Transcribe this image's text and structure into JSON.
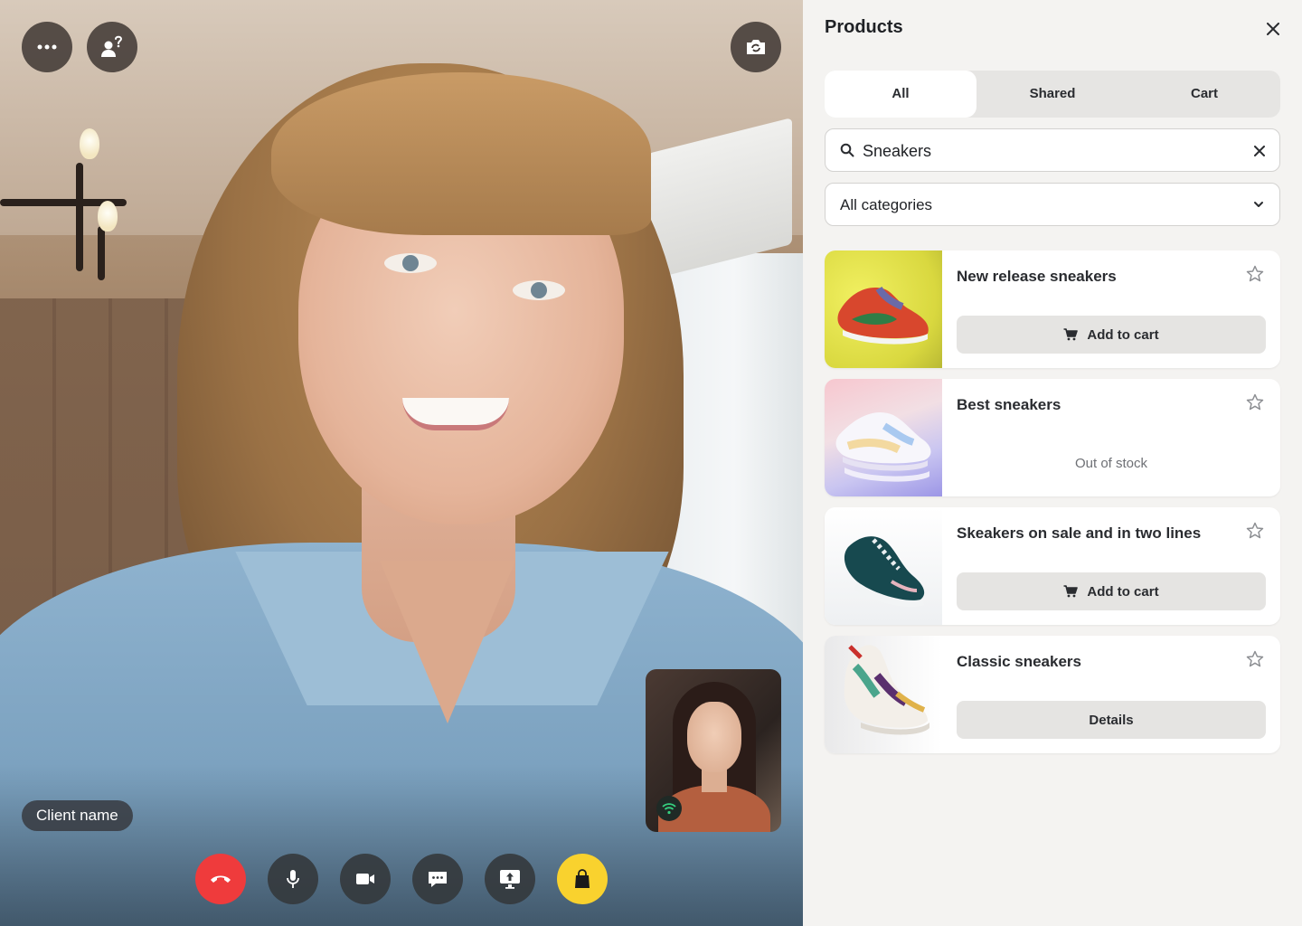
{
  "call": {
    "client_label": "Client name"
  },
  "panel": {
    "title": "Products",
    "tabs": [
      {
        "label": "All",
        "active": true
      },
      {
        "label": "Shared",
        "active": false
      },
      {
        "label": "Cart",
        "active": false
      }
    ],
    "search": {
      "value": "Sneakers",
      "placeholder": ""
    },
    "category_select": {
      "selected": "All categories"
    },
    "products": [
      {
        "name": "New release sneakers",
        "action": "Add to cart",
        "status": ""
      },
      {
        "name": "Best sneakers",
        "action": "",
        "status": "Out of stock"
      },
      {
        "name": "Skeakers on sale and in two lines",
        "action": "Add to cart",
        "status": ""
      },
      {
        "name": "Classic sneakers",
        "action": "Details",
        "status": ""
      }
    ]
  },
  "colors": {
    "end_call": "#ef3b3c",
    "shop": "#f9d22e",
    "panel_bg": "#f4f3f1",
    "tab_active": "#ffffff",
    "tab_group": "#e6e5e3",
    "action_button": "#e5e4e2"
  },
  "icons": [
    "more-icon",
    "help-icon",
    "camera-switch-icon",
    "close-icon",
    "search-icon",
    "clear-icon",
    "chevron-down-icon",
    "star-icon",
    "cart-icon",
    "end-call-icon",
    "microphone-icon",
    "video-camera-icon",
    "chat-icon",
    "screen-share-icon",
    "shopping-bag-icon",
    "signal-icon"
  ]
}
